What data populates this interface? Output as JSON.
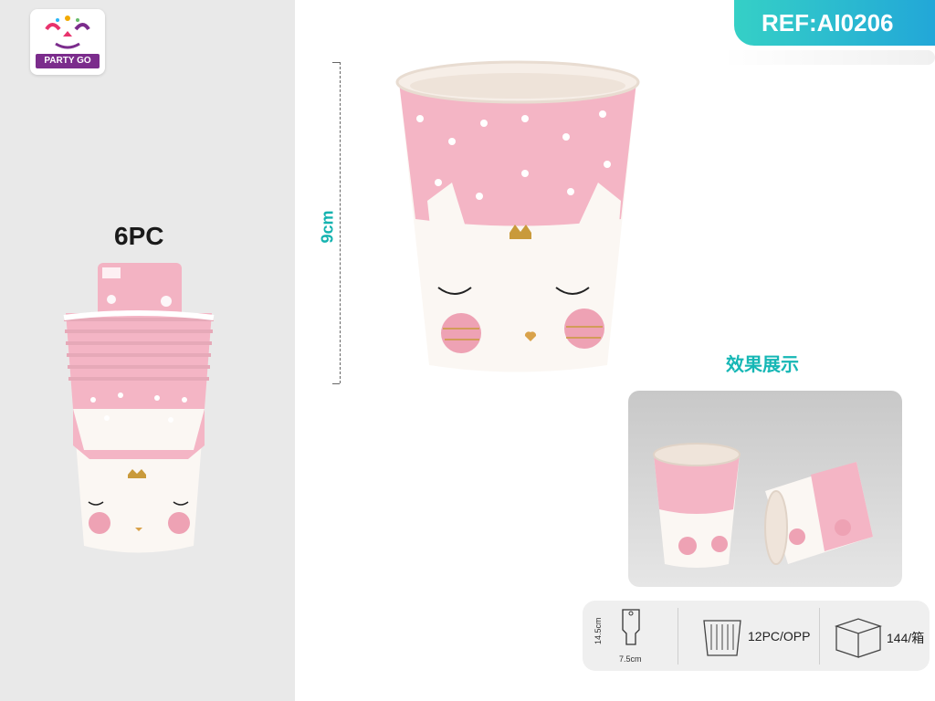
{
  "brand": {
    "logo_text": "PARTY GO"
  },
  "ref": {
    "label": "REF:AI0206"
  },
  "pack": {
    "count_label": "6PC"
  },
  "dimension": {
    "height_label": "9cm"
  },
  "effect": {
    "title": "效果展示"
  },
  "specs": {
    "card_height": "14.5cm",
    "card_width": "7.5cm",
    "per_pack": "12PC/OPP",
    "per_carton": "144/箱"
  },
  "colors": {
    "accent": "#16b7b5",
    "cup_pink": "#f4b5c5",
    "cup_white": "#fbf7f3",
    "panel_gray": "#e9e9e9"
  }
}
